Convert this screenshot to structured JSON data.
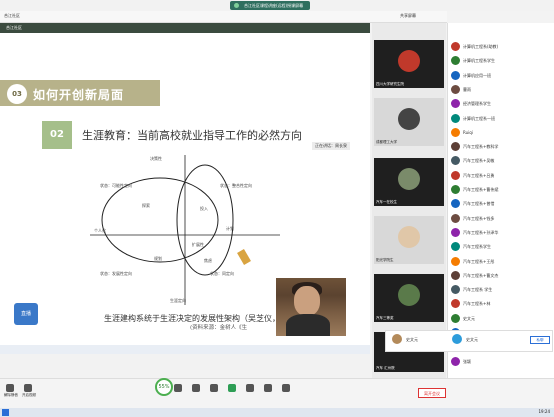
{
  "window": {
    "title": "合江社区课程讲座(远程)授课屏幕",
    "top_left_label": "合江社区",
    "top_center": "共享屏幕",
    "top_right_count": "成员(155)"
  },
  "slide": {
    "section_num": "03",
    "section_title": "如何开创新局面",
    "sub_num": "02",
    "sub_title": "生涯教育：当前高校就业指导工作的必然方向",
    "caption": "生涯建构系统于生涯决定的发展性架构（吴芝仪，1997）",
    "source": "(资料来源：金树人《生",
    "diagram_labels": [
      "状态：可能性定向",
      "状态：发展性定向",
      "决策性",
      "探索",
      "个人化",
      "规划",
      "状态：整合性定向",
      "发展性",
      "投入",
      "计划",
      "状态：发展性定向",
      "状态：同定向",
      "扩展性",
      "负面",
      "准备",
      "状态：发展性选定",
      "焦虑",
      "价值观",
      "目标明确",
      "生涯定向"
    ]
  },
  "speaker_tag": "正在讲话：周长泉",
  "video_tiles": [
    {
      "label": "四川大学研究生院"
    },
    {
      "label": "成都理工大学"
    },
    {
      "label": "汽车一在校生"
    },
    {
      "label": "阳光学院生"
    },
    {
      "label": "汽车三等奖"
    },
    {
      "label": "汽车 汇州院"
    }
  ],
  "participants": [
    "计算机工程系(助教)",
    "计算机工程系学生",
    "计算机应用一班",
    "曹雨",
    "经济管理系学生",
    "计算机工程系一班",
    "Ruiqi",
    "汽车工程系+教科学",
    "汽车工程系+吴敏",
    "汽车工程系+吕勇",
    "汽车工程系+曹伟斌",
    "汽车工程系+曾惜",
    "汽车工程系+钱多",
    "汽车工程系+孙泽华",
    "汽车工程系学生",
    "汽车工程系+王彤",
    "汽车工程系+曹文杰",
    "汽车工程系 学生",
    "汽车工程系+林",
    "史文元",
    "李学明",
    "四川 教育科研",
    "张颖"
  ],
  "popup": {
    "name1": "史文元",
    "name2": "史文元",
    "button": "私聊"
  },
  "toolbar": {
    "items": [
      "解除静音",
      "开启视频",
      "",
      "",
      "",
      "",
      "",
      "",
      "",
      "",
      "",
      "",
      ""
    ],
    "zoom": "55%",
    "leave": "离开会议"
  },
  "clock": "19:24"
}
